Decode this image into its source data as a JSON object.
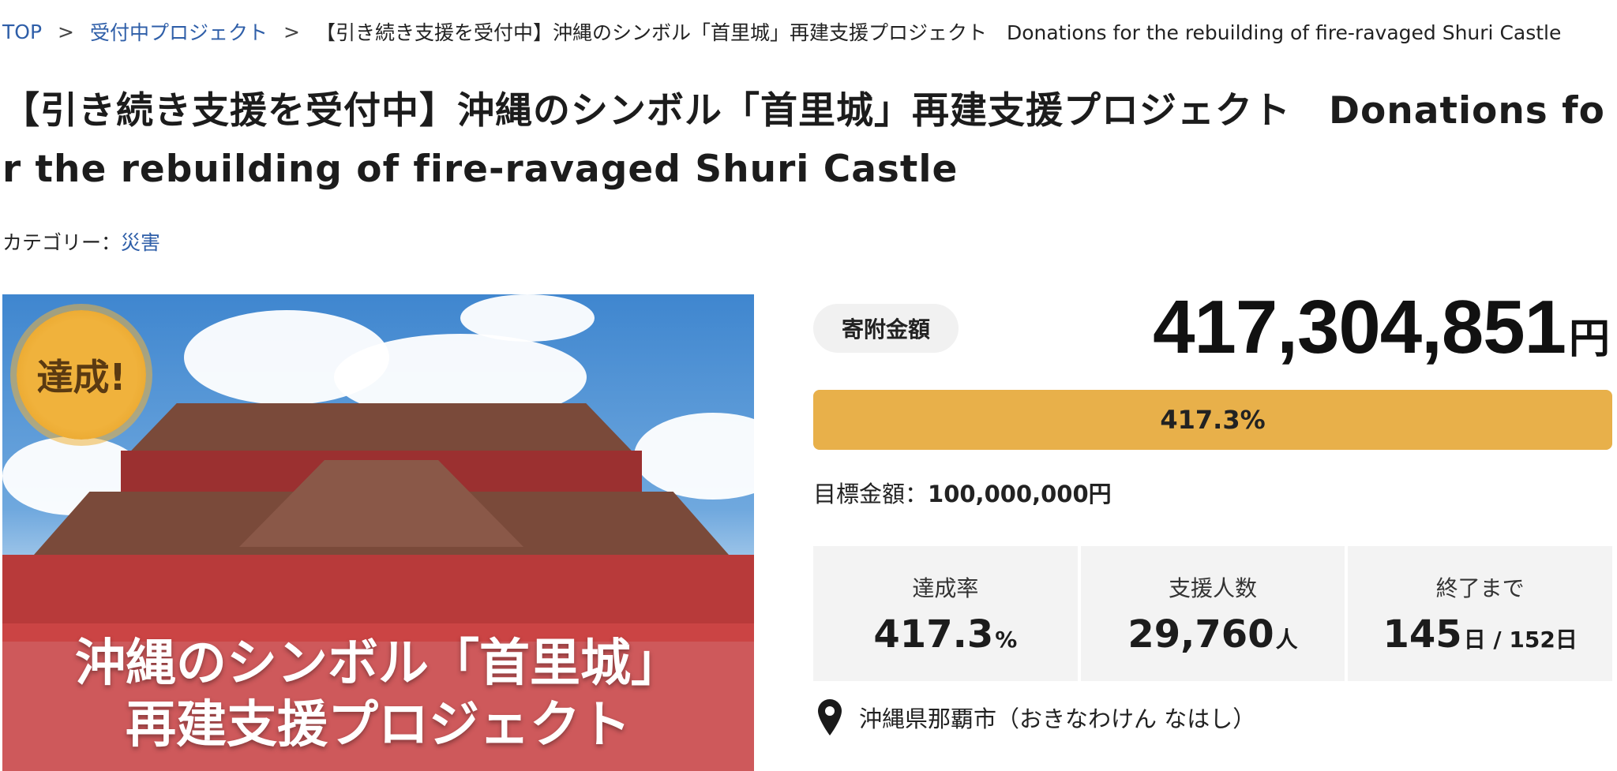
{
  "breadcrumb": {
    "top": "TOP",
    "sep1": ">",
    "section": "受付中プロジェクト",
    "sep2": ">",
    "current": "【引き続き支援を受付中】沖縄のシンボル「首里城」再建支援プロジェクト　Donations for the rebuilding of fire-ravaged Shuri Castle"
  },
  "page": {
    "title": "【引き続き支援を受付中】沖縄のシンボル「首里城」再建支援プロジェクト　Donations for the rebuilding of fire-ravaged Shuri Castle"
  },
  "category": {
    "label": "カテゴリー：",
    "value": "災害"
  },
  "hero": {
    "badge": "達成!",
    "caption_line1": "沖縄のシンボル「首里城」",
    "caption_line2": "再建支援プロジェクト"
  },
  "funding": {
    "label": "寄附金額",
    "amount": "417,304,851",
    "currency": "円",
    "progress_text": "417.3%",
    "progress_fraction": 1.0,
    "goal_label": "目標金額：",
    "goal_value": "100,000,000円",
    "accent": "#e8b04a"
  },
  "stats": {
    "rate_label": "達成率",
    "rate_value": "417.3",
    "rate_unit": "%",
    "supporters_label": "支援人数",
    "supporters_value": "29,760",
    "supporters_unit": "人",
    "remaining_label": "終了まで",
    "remaining_value": "145",
    "remaining_unit": "日 / 152日"
  },
  "location": {
    "text": "沖縄県那覇市（おきなわけん なはし）",
    "icon": "map-pin-icon"
  }
}
